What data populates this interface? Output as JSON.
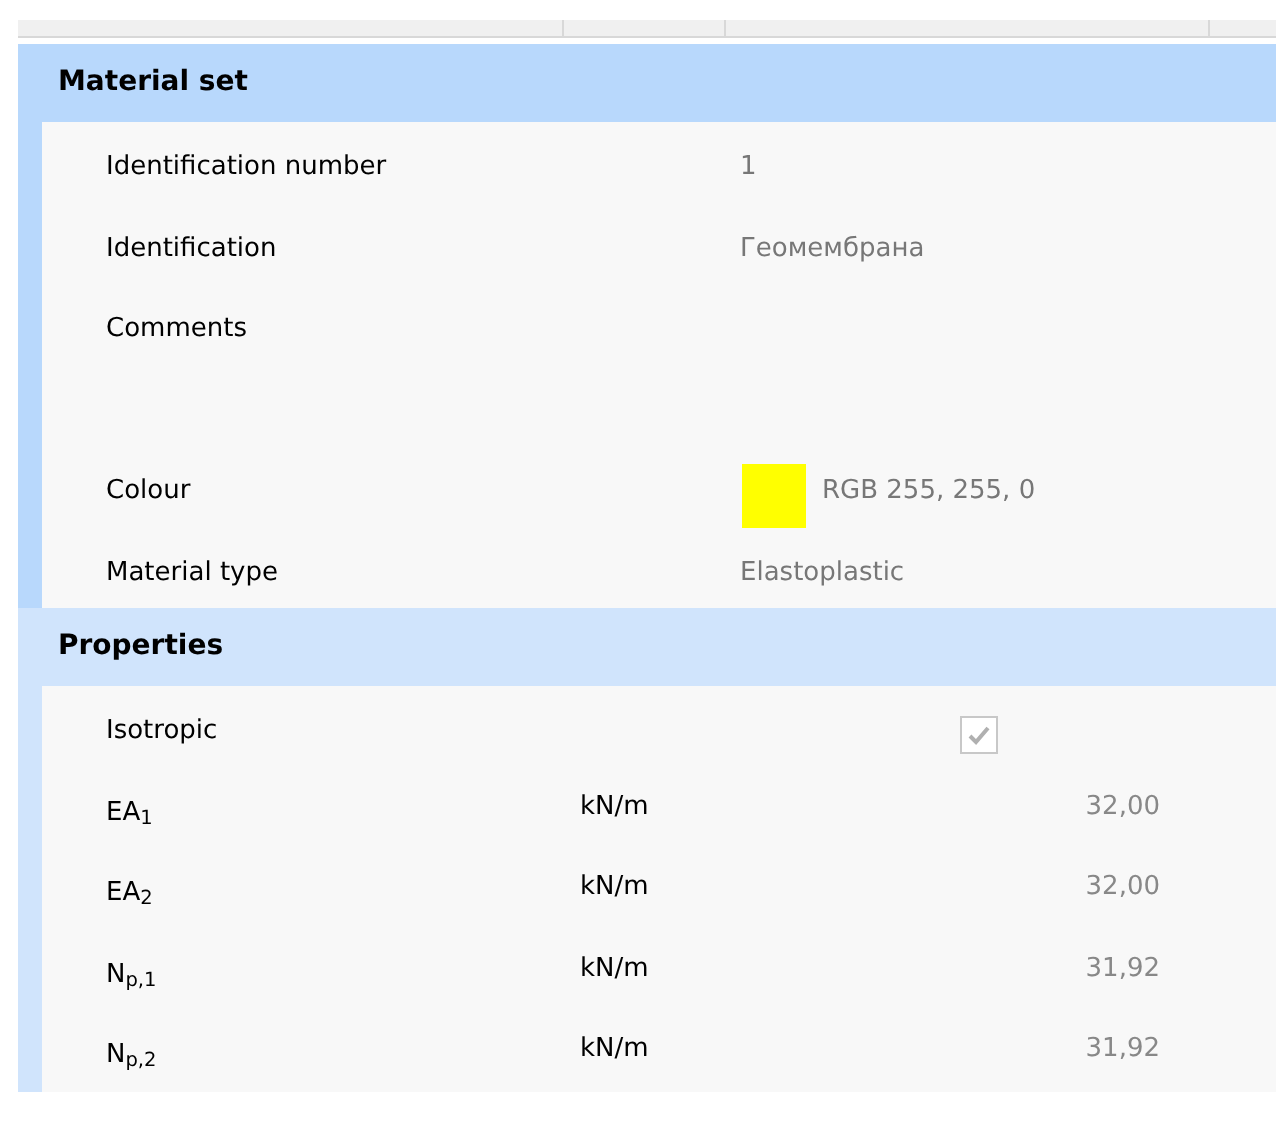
{
  "sections": [
    {
      "title": "Material set",
      "color": "#b8d8fc",
      "rows": [
        {
          "kind": "text",
          "label": "Identification number",
          "value": "1"
        },
        {
          "kind": "text",
          "label": "Identification",
          "value": "Геомембрана"
        },
        {
          "kind": "memo",
          "label": "Comments"
        },
        {
          "kind": "color",
          "label": "Colour",
          "color": "#ffff00",
          "value": "RGB 255, 255, 0"
        },
        {
          "kind": "text",
          "label": "Material type",
          "value": "Elastoplastic"
        }
      ]
    },
    {
      "title": "Properties",
      "color": "#d0e4fc",
      "rows": [
        {
          "kind": "checkbox",
          "label": "Isotropic",
          "checked": true
        },
        {
          "kind": "quantity",
          "label": "EA$_{1}$",
          "unit": "kN/m",
          "value": "32,00"
        },
        {
          "kind": "quantity",
          "label": "EA$_{2}$",
          "unit": "kN/m",
          "value": "32,00"
        },
        {
          "kind": "quantity",
          "label": "N$_{p,1}$",
          "unit": "kN/m",
          "value": "31,92"
        },
        {
          "kind": "quantity",
          "label": "N$_{p,2}$",
          "unit": "kN/m",
          "value": "31,92"
        }
      ]
    }
  ]
}
